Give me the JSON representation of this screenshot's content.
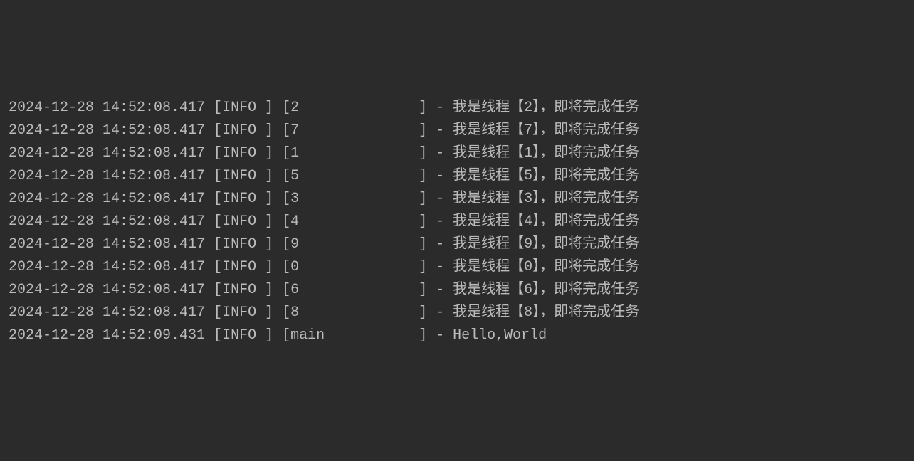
{
  "logs": [
    {
      "timestamp": "2024-12-28 14:52:08.417",
      "level": "INFO ",
      "thread": "2",
      "message": "我是线程【2】，即将完成任务"
    },
    {
      "timestamp": "2024-12-28 14:52:08.417",
      "level": "INFO ",
      "thread": "7",
      "message": "我是线程【7】，即将完成任务"
    },
    {
      "timestamp": "2024-12-28 14:52:08.417",
      "level": "INFO ",
      "thread": "1",
      "message": "我是线程【1】，即将完成任务"
    },
    {
      "timestamp": "2024-12-28 14:52:08.417",
      "level": "INFO ",
      "thread": "5",
      "message": "我是线程【5】，即将完成任务"
    },
    {
      "timestamp": "2024-12-28 14:52:08.417",
      "level": "INFO ",
      "thread": "3",
      "message": "我是线程【3】，即将完成任务"
    },
    {
      "timestamp": "2024-12-28 14:52:08.417",
      "level": "INFO ",
      "thread": "4",
      "message": "我是线程【4】，即将完成任务"
    },
    {
      "timestamp": "2024-12-28 14:52:08.417",
      "level": "INFO ",
      "thread": "9",
      "message": "我是线程【9】，即将完成任务"
    },
    {
      "timestamp": "2024-12-28 14:52:08.417",
      "level": "INFO ",
      "thread": "0",
      "message": "我是线程【0】，即将完成任务"
    },
    {
      "timestamp": "2024-12-28 14:52:08.417",
      "level": "INFO ",
      "thread": "6",
      "message": "我是线程【6】，即将完成任务"
    },
    {
      "timestamp": "2024-12-28 14:52:08.417",
      "level": "INFO ",
      "thread": "8",
      "message": "我是线程【8】，即将完成任务"
    },
    {
      "timestamp": "2024-12-28 14:52:09.431",
      "level": "INFO ",
      "thread": "main",
      "message": "Hello,World"
    }
  ],
  "thread_field_width": 15
}
